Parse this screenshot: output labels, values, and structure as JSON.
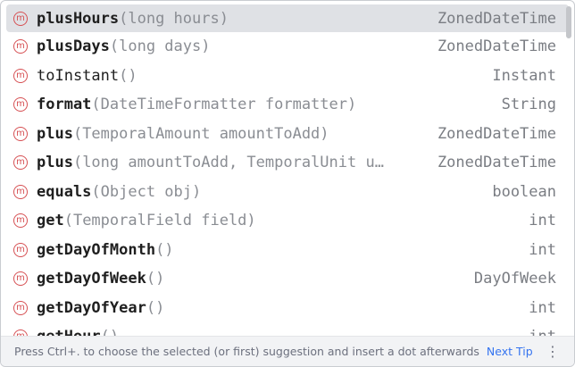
{
  "completion": {
    "items": [
      {
        "icon": "method-icon",
        "badge": "m",
        "name": "plusHours",
        "params": "(long hours)",
        "return_type": "ZonedDateTime",
        "selected": true
      },
      {
        "icon": "method-icon",
        "badge": "m",
        "name": "plusDays",
        "params": "(long days)",
        "return_type": "ZonedDateTime"
      },
      {
        "icon": "method-icon",
        "badge": "m",
        "name": "toInstant",
        "params": "()",
        "return_type": "Instant"
      },
      {
        "icon": "method-icon",
        "badge": "m",
        "name": "format",
        "params": "(DateTimeFormatter formatter)",
        "return_type": "String"
      },
      {
        "icon": "method-icon",
        "badge": "m",
        "name": "plus",
        "params": "(TemporalAmount amountToAdd)",
        "return_type": "ZonedDateTime"
      },
      {
        "icon": "method-icon",
        "badge": "m",
        "name": "plus",
        "params": "(long amountToAdd, TemporalUnit u…",
        "return_type": "ZonedDateTime"
      },
      {
        "icon": "method-icon",
        "badge": "m",
        "name": "equals",
        "params": "(Object obj)",
        "return_type": "boolean"
      },
      {
        "icon": "method-icon",
        "badge": "m",
        "name": "get",
        "params": "(TemporalField field)",
        "return_type": "int"
      },
      {
        "icon": "method-icon",
        "badge": "m",
        "name": "getDayOfMonth",
        "params": "()",
        "return_type": "int"
      },
      {
        "icon": "method-icon",
        "badge": "m",
        "name": "getDayOfWeek",
        "params": "()",
        "return_type": "DayOfWeek"
      },
      {
        "icon": "method-icon",
        "badge": "m",
        "name": "getDayOfYear",
        "params": "()",
        "return_type": "int"
      },
      {
        "icon": "method-icon",
        "badge": "m",
        "name": "getHour",
        "params": "()",
        "return_type": "int"
      }
    ]
  },
  "footer": {
    "hint": "Press Ctrl+. to choose the selected (or first) suggestion and insert a dot afterwards",
    "next_tip": "Next Tip",
    "more_icon": "more-vertical-icon"
  },
  "colors": {
    "method_icon": "#d65053",
    "selected_bg": "#dfe1e5",
    "link": "#3574f0"
  }
}
